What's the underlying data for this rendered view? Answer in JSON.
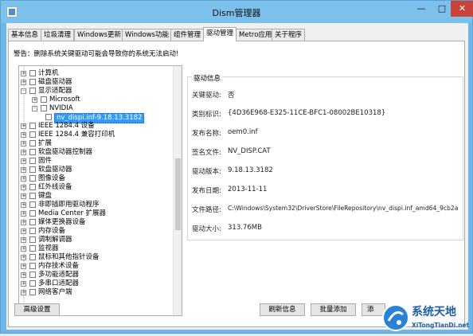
{
  "window": {
    "title": "Dism管理器"
  },
  "tabs": [
    "基本信息",
    "垃圾清理",
    "Windows更新",
    "Windows功能",
    "组件管理",
    "驱动管理",
    "Metro应用",
    "关于程序"
  ],
  "warning": "警告：删除系统关键驱动可能会导致你的系统无法启动!",
  "tree": [
    {
      "label": "计算机",
      "expander": "+"
    },
    {
      "label": "磁盘驱动器",
      "expander": "+"
    },
    {
      "label": "显示适配器",
      "expander": "-"
    },
    {
      "label": "Microsoft",
      "expander": "+"
    },
    {
      "label": "NVIDIA",
      "expander": "-"
    },
    {
      "label": "nv_dispi.inf-9.18.13.3182",
      "selected": true
    },
    {
      "label": "IEEE 1284.4 设备",
      "expander": "+"
    },
    {
      "label": "IEEE 1284.4 兼容打印机",
      "expander": "+"
    },
    {
      "label": "扩展",
      "expander": "+"
    },
    {
      "label": "软盘驱动器控制器",
      "expander": "+"
    },
    {
      "label": "固件",
      "expander": "+"
    },
    {
      "label": "软盘驱动器",
      "expander": "+"
    },
    {
      "label": "图像设备",
      "expander": "+"
    },
    {
      "label": "红外线设备",
      "expander": "+"
    },
    {
      "label": "键盘",
      "expander": "+"
    },
    {
      "label": "非即插即用驱动程序",
      "expander": "+"
    },
    {
      "label": "Media Center 扩展器",
      "expander": "+"
    },
    {
      "label": "媒体更换器设备",
      "expander": "+"
    },
    {
      "label": "内存设备",
      "expander": "+"
    },
    {
      "label": "调制解调器",
      "expander": "+"
    },
    {
      "label": "监视器",
      "expander": "+"
    },
    {
      "label": "鼠标和其他指针设备",
      "expander": "+"
    },
    {
      "label": "内存技术设备",
      "expander": "+"
    },
    {
      "label": "多功能适配器",
      "expander": "+"
    },
    {
      "label": "多串口适配器",
      "expander": "+"
    },
    {
      "label": "网络客户端",
      "expander": "+"
    }
  ],
  "driver_info": {
    "title": "驱动信息",
    "rows": [
      {
        "key": "关键驱动:",
        "value": "否"
      },
      {
        "key": "类别标识:",
        "value": "{4D36E968-E325-11CE-BFC1-08002BE10318}"
      },
      {
        "key": "发布名称:",
        "value": "oem0.inf"
      },
      {
        "key": "签名文件:",
        "value": "NV_DISP.CAT"
      },
      {
        "key": "驱动版本:",
        "value": "9.18.13.3182"
      },
      {
        "key": "发布日期:",
        "value": "2013-11-11"
      },
      {
        "key": "文件路径:",
        "value": "C:\\Windows\\System32\\DriverStore\\FileRepository\\nv_dispi.inf_amd64_9cb2a"
      },
      {
        "key": "驱动大小:",
        "value": "313.76MB"
      }
    ]
  },
  "buttons": {
    "advanced": "高级设置",
    "refresh": "刷新信息",
    "batch_add": "批量添加",
    "partial": "添"
  },
  "watermark": {
    "main": "系统天地",
    "url": "XiTongTianDi.net"
  }
}
